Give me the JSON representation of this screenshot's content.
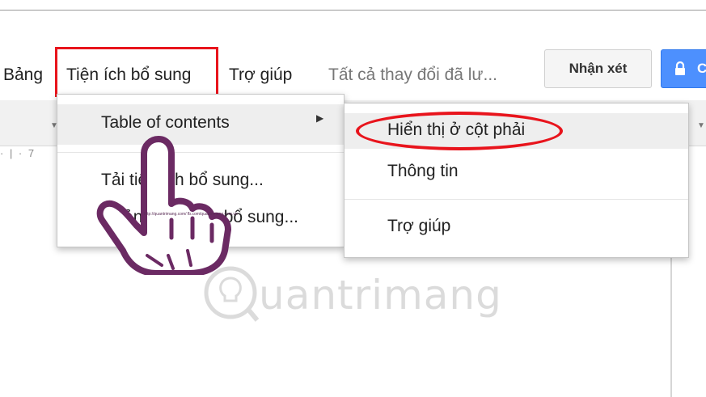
{
  "menubar": {
    "items": [
      {
        "label": "Bảng"
      },
      {
        "label": "Tiện ích bổ sung"
      },
      {
        "label": "Trợ giúp"
      }
    ],
    "save_status": "Tất cả thay đổi đã lư..."
  },
  "buttons": {
    "comment": "Nhận xét",
    "share_partial": "C"
  },
  "ruler": {
    "text": "· | · 7"
  },
  "addons_menu": {
    "items": [
      {
        "label": "Table of contents",
        "has_submenu": true,
        "highlighted": true
      },
      {
        "label": "Tải tiện ích bổ sung..."
      },
      {
        "label": "Quản lý tiện ích bổ sung..."
      }
    ]
  },
  "toc_submenu": {
    "items": [
      {
        "label": "Hiển thị ở cột phải",
        "highlighted": true
      },
      {
        "label": "Thông tin"
      },
      {
        "label": "Trợ giúp"
      }
    ]
  },
  "watermark": {
    "text": "uantrimang",
    "brand": "Quantrimang"
  },
  "overlay": {
    "hand_caption": "http://quantrimang.com/ fb.com/quantrimang.com.vn",
    "highlight_color": "#e8141c",
    "hand_color": "#6b2a63"
  },
  "colors": {
    "share_button": "#4d90fe",
    "menu_active_bg": "#eeeeee"
  }
}
